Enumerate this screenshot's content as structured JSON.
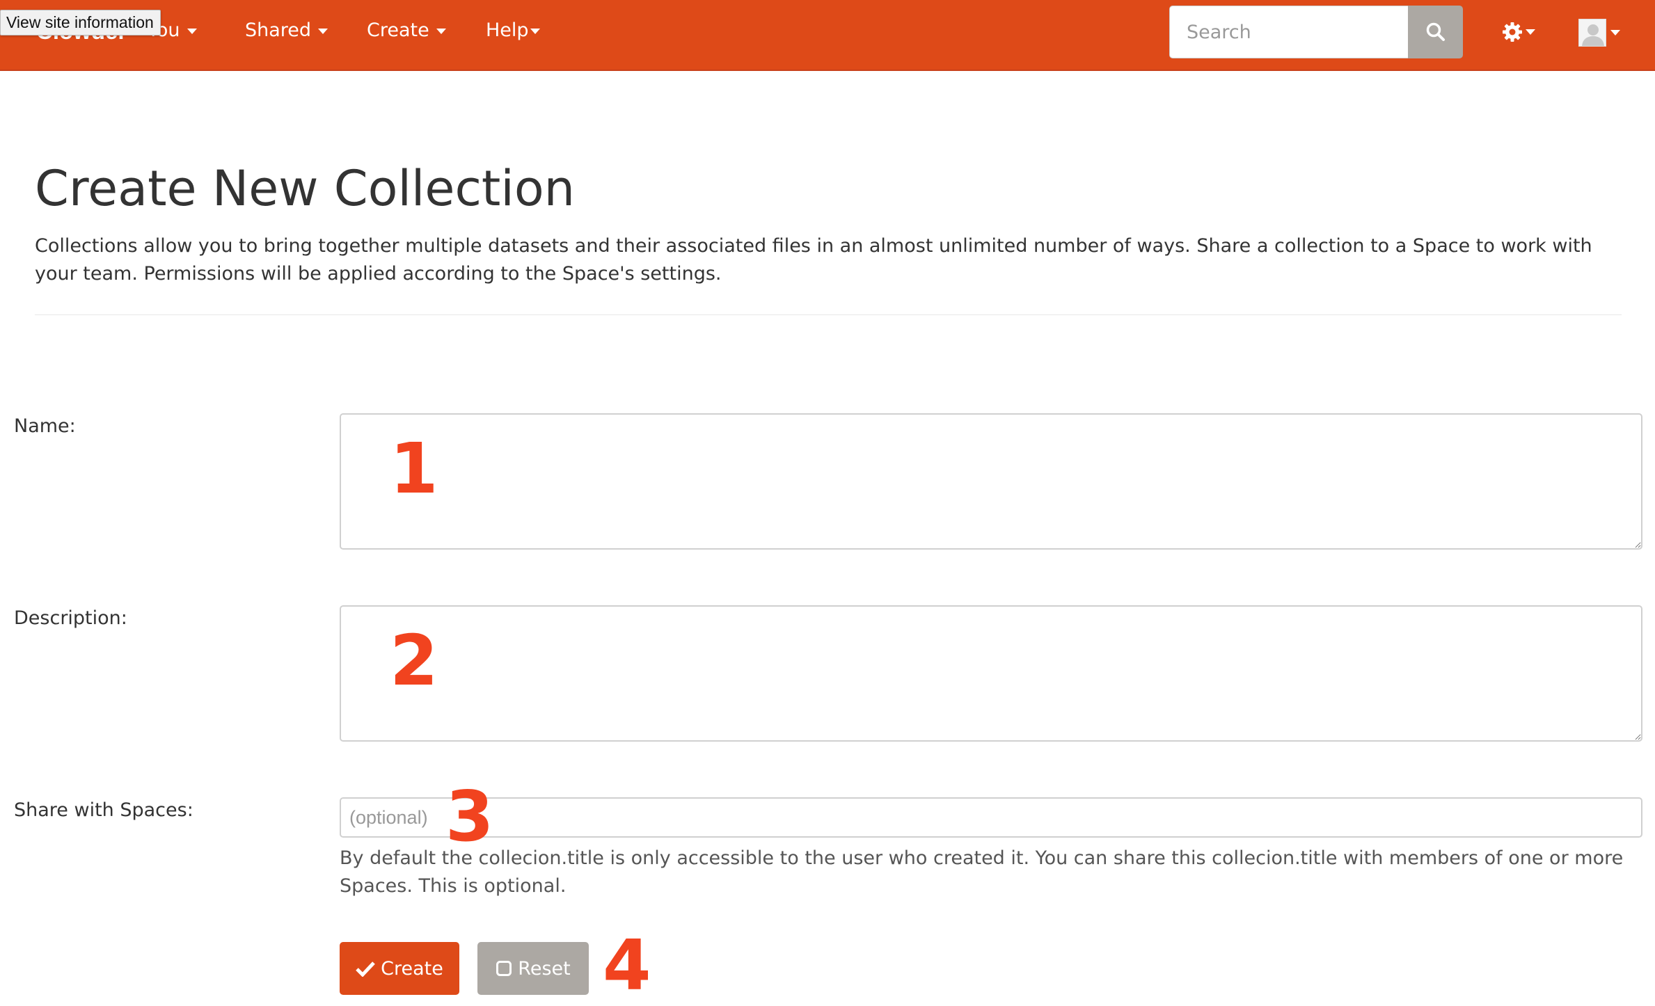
{
  "tooltip": "View site information",
  "navbar": {
    "brand": "Clowder",
    "items": [
      {
        "label": "You"
      },
      {
        "label": "Shared"
      },
      {
        "label": "Create"
      },
      {
        "label": "Help"
      }
    ],
    "search_placeholder": "Search"
  },
  "page": {
    "title": "Create New Collection",
    "intro": "Collections allow you to bring together multiple datasets and their associated files in an almost unlimited number of ways. Share a collection to a Space to work with your team. Permissions will be applied according to the Space's settings."
  },
  "form": {
    "name_label": "Name:",
    "description_label": "Description:",
    "spaces_label": "Share with Spaces:",
    "spaces_placeholder": "(optional)",
    "spaces_help": "By default the collecion.title is only accessible to the user who created it. You can share this collecion.title with members of one or more Spaces. This is optional.",
    "create_label": "Create",
    "reset_label": "Reset"
  },
  "annotations": [
    "1",
    "2",
    "3",
    "4"
  ],
  "colors": {
    "navbar": "#de4a18",
    "button_primary": "#de4a18",
    "button_secondary": "#aca8a3",
    "annotation": "#f1431f"
  },
  "icons": [
    "search-icon",
    "gear-icon",
    "user-avatar-icon",
    "check-icon",
    "square-icon"
  ]
}
